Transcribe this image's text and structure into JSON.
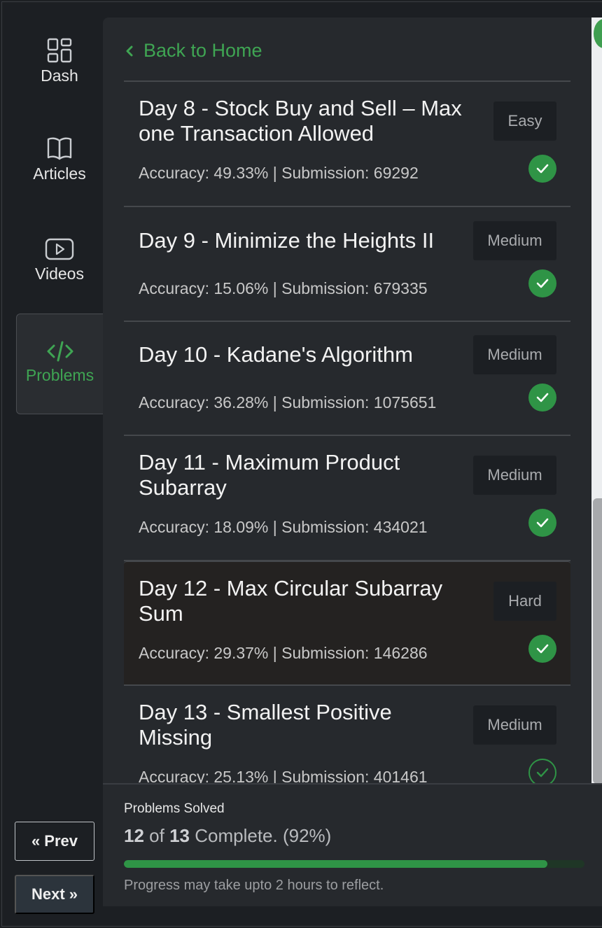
{
  "sidebar": {
    "items": [
      {
        "label": "Dash",
        "icon": "dashboard-icon",
        "active": false
      },
      {
        "label": "Articles",
        "icon": "book-icon",
        "active": false
      },
      {
        "label": "Videos",
        "icon": "play-icon",
        "active": false
      },
      {
        "label": "Problems",
        "icon": "code-icon",
        "active": true
      }
    ],
    "prev_label": "Prev",
    "next_label": "Next"
  },
  "back": {
    "label": "Back to Home"
  },
  "problems": [
    {
      "title": "Day 8 - Stock Buy and Sell – Max one Transaction Allowed",
      "difficulty": "Easy",
      "meta": "Accuracy: 49.33% | Submission: 69292",
      "solved": true
    },
    {
      "title": "Day 9 - Minimize the Heights II",
      "difficulty": "Medium",
      "meta": "Accuracy: 15.06% | Submission: 679335",
      "solved": true
    },
    {
      "title": "Day 10 - Kadane's Algorithm",
      "difficulty": "Medium",
      "meta": "Accuracy: 36.28% | Submission: 1075651",
      "solved": true
    },
    {
      "title": "Day 11 - Maximum Product Subarray",
      "difficulty": "Medium",
      "meta": "Accuracy: 18.09% | Submission: 434021",
      "solved": true
    },
    {
      "title": "Day 12 - Max Circular Subarray Sum",
      "difficulty": "Hard",
      "meta": "Accuracy: 29.37% | Submission: 146286",
      "solved": true
    },
    {
      "title": "Day 13 - Smallest Positive Missing",
      "difficulty": "Medium",
      "meta": "Accuracy: 25.13% | Submission: 401461",
      "solved": false
    }
  ],
  "progress": {
    "label": "Problems Solved",
    "solved": "12",
    "of_word": "of",
    "total": "13",
    "suffix": "Complete. (92%)",
    "fraction": 0.92,
    "note": "Progress may take upto 2 hours to reflect."
  },
  "colors": {
    "accent": "#3fa553",
    "badge_bg": "#1c1f23",
    "panel_bg": "#26292d"
  }
}
